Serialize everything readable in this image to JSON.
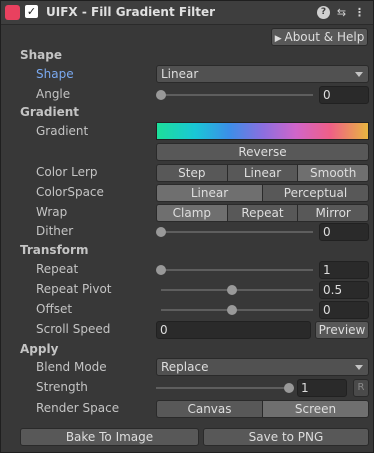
{
  "header": {
    "logo_text": "UIFX",
    "title": "UIFX - Fill Gradient Filter"
  },
  "about_button": "About & Help",
  "sections": {
    "shape": "Shape",
    "gradient": "Gradient",
    "transform": "Transform",
    "apply": "Apply"
  },
  "shape": {
    "shape_label": "Shape",
    "shape_value": "Linear",
    "angle_label": "Angle",
    "angle_value": "0",
    "angle_fraction": 0
  },
  "gradient": {
    "gradient_label": "Gradient",
    "reverse_label": "Reverse",
    "color_lerp_label": "Color Lerp",
    "color_lerp_options": [
      "Step",
      "Linear",
      "Smooth"
    ],
    "color_lerp_selected": "Smooth",
    "colorspace_label": "ColorSpace",
    "colorspace_options": [
      "Linear",
      "Perceptual"
    ],
    "colorspace_selected": "Linear",
    "wrap_label": "Wrap",
    "wrap_options": [
      "Clamp",
      "Repeat",
      "Mirror"
    ],
    "wrap_selected": "Clamp",
    "dither_label": "Dither",
    "dither_value": "0",
    "dither_fraction": 0
  },
  "transform": {
    "repeat_label": "Repeat",
    "repeat_value": "1",
    "repeat_fraction": 0,
    "repeat_pivot_label": "Repeat Pivot",
    "repeat_pivot_value": "0.5",
    "repeat_pivot_fraction": 0.5,
    "offset_label": "Offset",
    "offset_value": "0",
    "offset_fraction": 0.5,
    "scroll_speed_label": "Scroll Speed",
    "scroll_speed_value": "0",
    "preview_label": "Preview"
  },
  "apply": {
    "blend_mode_label": "Blend Mode",
    "blend_mode_value": "Replace",
    "strength_label": "Strength",
    "strength_value": "1",
    "strength_fraction": 1,
    "lock_label": "R",
    "render_space_label": "Render Space",
    "render_space_options": [
      "Canvas",
      "Screen"
    ],
    "render_space_selected": "Screen"
  },
  "footer": {
    "bake_label": "Bake To Image",
    "save_label": "Save to PNG"
  }
}
